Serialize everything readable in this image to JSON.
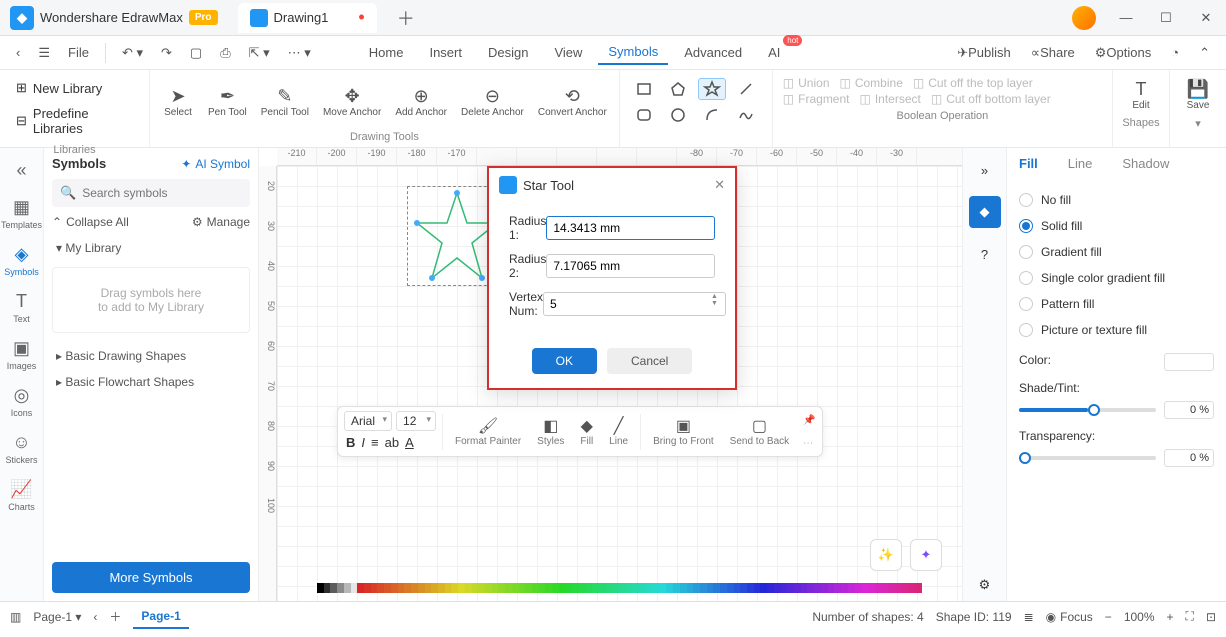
{
  "titlebar": {
    "appname": "Wondershare EdrawMax",
    "pro": "Pro",
    "tab_name": "Drawing1"
  },
  "menubar": {
    "file": "File",
    "items": [
      "Home",
      "Insert",
      "Design",
      "View",
      "Symbols",
      "Advanced",
      "AI"
    ],
    "active": "Symbols",
    "hot": "hot",
    "publish": "Publish",
    "share": "Share",
    "options": "Options"
  },
  "toolbar": {
    "libraries": {
      "new": "New Library",
      "predef": "Predefine Libraries",
      "label": "Libraries"
    },
    "drawing": {
      "select": "Select",
      "pen": "Pen Tool",
      "pencil": "Pencil Tool",
      "move": "Move Anchor",
      "add": "Add Anchor",
      "del": "Delete Anchor",
      "conv": "Convert Anchor",
      "label": "Drawing Tools"
    },
    "bool": {
      "union": "Union",
      "combine": "Combine",
      "cuttop": "Cut off the top layer",
      "fragment": "Fragment",
      "intersect": "Intersect",
      "cutbot": "Cut off bottom layer",
      "label": "Boolean Operation"
    },
    "edit": {
      "edit": "Edit",
      "shapes": "Shapes"
    },
    "save": "Save"
  },
  "leftrail": {
    "templates": "Templates",
    "symbols": "Symbols",
    "text": "Text",
    "images": "Images",
    "icons": "Icons",
    "stickers": "Stickers",
    "charts": "Charts"
  },
  "leftpanel": {
    "title": "Symbols",
    "ai": "AI Symbol",
    "search_ph": "Search symbols",
    "collapse": "Collapse All",
    "manage": "Manage",
    "mylib": "My Library",
    "drop1": "Drag symbols here",
    "drop2": "to add to My Library",
    "basic": "Basic Drawing Shapes",
    "flow": "Basic Flowchart Shapes",
    "more": "More Symbols"
  },
  "ruler_h": [
    "-210",
    "-200",
    "-190",
    "-180",
    "-170",
    "",
    "",
    "",
    "",
    "",
    "-80",
    "-70",
    "-60",
    "-50",
    "-40",
    "-30"
  ],
  "ruler_v": [
    "20",
    "30",
    "40",
    "50",
    "60",
    "70",
    "80",
    "90",
    "100"
  ],
  "dialog": {
    "title": "Star Tool",
    "r1_label": "Radius 1:",
    "r1_val": "14.3413 mm",
    "r2_label": "Radius 2:",
    "r2_val": "7.17065 mm",
    "vn_label": "Vertex Num:",
    "vn_val": "5",
    "ok": "OK",
    "cancel": "Cancel"
  },
  "floatfmt": {
    "font": "Arial",
    "size": "12",
    "fp": "Format Painter",
    "styles": "Styles",
    "fill": "Fill",
    "line": "Line",
    "bring": "Bring to Front",
    "send": "Send to Back"
  },
  "rightpanel": {
    "tabs": {
      "fill": "Fill",
      "line": "Line",
      "shadow": "Shadow"
    },
    "nofill": "No fill",
    "solid": "Solid fill",
    "grad": "Gradient fill",
    "single": "Single color gradient fill",
    "pattern": "Pattern fill",
    "pict": "Picture or texture fill",
    "color": "Color:",
    "shade": "Shade/Tint:",
    "shade_val": "0 %",
    "trans": "Transparency:",
    "trans_val": "0 %"
  },
  "status": {
    "page": "Page-1",
    "pagetab": "Page-1",
    "shapes": "Number of shapes: 4",
    "shapeid": "Shape ID: 119",
    "focus": "Focus",
    "zoom": "100%"
  }
}
